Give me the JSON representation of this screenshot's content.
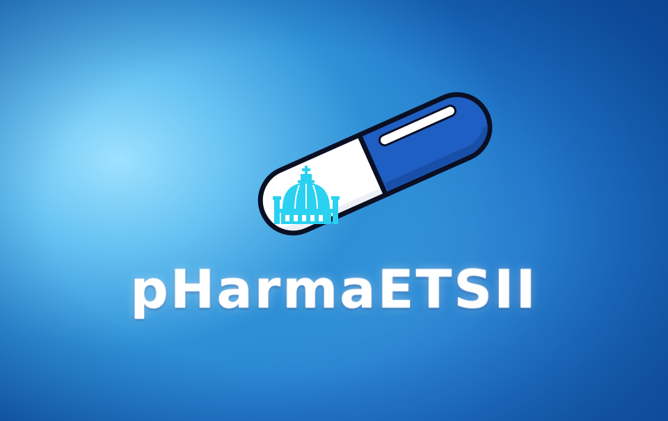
{
  "app": {
    "name": "pHarmaETSII"
  },
  "colors": {
    "capsule_blue": "#1f5fc4",
    "capsule_white": "#ffffff",
    "dome_cyan": "#2ad1f0",
    "outline": "#0a0f24",
    "background_light": "#9ee1ff",
    "background_dark": "#0d55a8"
  },
  "icons": {
    "capsule": "pill-capsule-icon",
    "dome": "building-dome-icon"
  }
}
